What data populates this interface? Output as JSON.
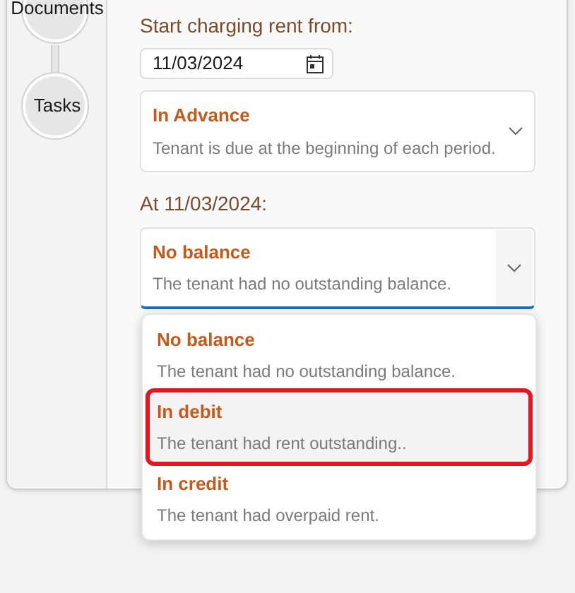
{
  "steps": [
    {
      "label": "Documents"
    },
    {
      "label": "Tasks"
    }
  ],
  "start_label": "Start charging rent from:",
  "start_date": {
    "value": "11/03/2024"
  },
  "timing": {
    "title": "In Advance",
    "description": "Tenant is due at the beginning of each period."
  },
  "balance_label": "At 11/03/2024:",
  "balance": {
    "title": "No balance",
    "description": "The tenant had no outstanding balance.",
    "expanded": true
  },
  "options": [
    {
      "title": "No balance",
      "description": "The tenant had no outstanding balance.",
      "selected": false
    },
    {
      "title": "In debit",
      "description": "The tenant had rent outstanding..",
      "selected": true
    },
    {
      "title": "In credit",
      "description": "The tenant had overpaid rent.",
      "selected": false
    }
  ]
}
